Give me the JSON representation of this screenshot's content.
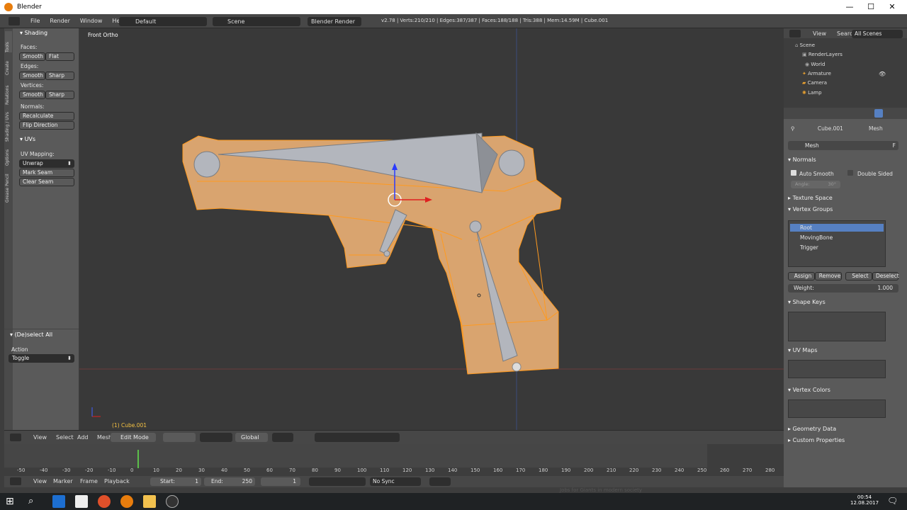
{
  "window": {
    "title": "Blender",
    "minimize": "—",
    "maximize": "☐",
    "close": "✕"
  },
  "menubar": {
    "items": [
      "File",
      "Render",
      "Window",
      "Help"
    ],
    "layout": "Default",
    "scene": "Scene",
    "engine": "Blender Render",
    "stats": "v2.78 | Verts:210/210 | Edges:387/387 | Faces:188/188 | Tris:388 | Mem:14.59M | Cube.001"
  },
  "tool_shelf": {
    "tabs": [
      "Tools",
      "Create",
      "Relations",
      "Shading / UVs",
      "Options",
      "Grease Pencil"
    ],
    "shading_header": "Shading",
    "faces_label": "Faces:",
    "edges_label": "Edges:",
    "vertices_label": "Vertices:",
    "smooth": "Smooth",
    "flat": "Flat",
    "sharp": "Sharp",
    "normals_label": "Normals:",
    "recalculate": "Recalculate",
    "flip_direction": "Flip Direction",
    "uvs_header": "UVs",
    "uv_mapping_label": "UV Mapping:",
    "unwrap": "Unwrap",
    "mark_seam": "Mark Seam",
    "clear_seam": "Clear Seam",
    "operator_header": "(De)select All",
    "action_label": "Action",
    "action_value": "Toggle"
  },
  "viewport": {
    "view_label": "Front Ortho",
    "object_label": "(1) Cube.001"
  },
  "viewport_header": {
    "menus": [
      "View",
      "Select",
      "Add",
      "Mesh"
    ],
    "mode": "Edit Mode",
    "orientation": "Global"
  },
  "timeline": {
    "ticks": [
      "-50",
      "-40",
      "-30",
      "-20",
      "-10",
      "0",
      "10",
      "20",
      "30",
      "40",
      "50",
      "60",
      "70",
      "80",
      "90",
      "100",
      "110",
      "120",
      "130",
      "140",
      "150",
      "160",
      "170",
      "180",
      "190",
      "200",
      "210",
      "220",
      "230",
      "240",
      "250",
      "260",
      "270",
      "280"
    ],
    "menus": [
      "View",
      "Marker",
      "Frame",
      "Playback"
    ],
    "start_label": "Start:",
    "start_value": "1",
    "end_label": "End:",
    "end_value": "250",
    "current_frame": "1",
    "sync": "No Sync"
  },
  "outliner": {
    "menus": [
      "View",
      "Search"
    ],
    "filter": "All Scenes",
    "rows": [
      "Scene",
      "RenderLayers",
      "World",
      "Armature",
      "Camera",
      "Lamp"
    ]
  },
  "properties": {
    "breadcrumb_object": "Cube.001",
    "breadcrumb_data": "Mesh",
    "datablock": "Mesh",
    "datablock_flag": "F",
    "normals_header": "Normals",
    "auto_smooth": "Auto Smooth",
    "double_sided": "Double Sided",
    "angle": "Angle:",
    "angle_value": "30°",
    "texture_space": "Texture Space",
    "vertex_groups": "Vertex Groups",
    "groups": [
      "Root",
      "MovingBone",
      "Trigger"
    ],
    "assign": "Assign",
    "remove": "Remove",
    "select": "Select",
    "deselect": "Deselect",
    "weight_label": "Weight:",
    "weight_value": "1.000",
    "shape_keys": "Shape Keys",
    "uv_maps": "UV Maps",
    "vertex_colors": "Vertex Colors",
    "geometry_data": "Geometry Data",
    "custom_properties": "Custom Properties"
  },
  "taskbar": {
    "time": "00:54",
    "date": "12.08.2017",
    "background_text": "Jobs for Giants in modern society"
  },
  "colors": {
    "mesh": "#d9a46f",
    "mesh_edge": "#ff9a1f",
    "bone": "#b3b6bd",
    "selected": "#5680c2"
  }
}
